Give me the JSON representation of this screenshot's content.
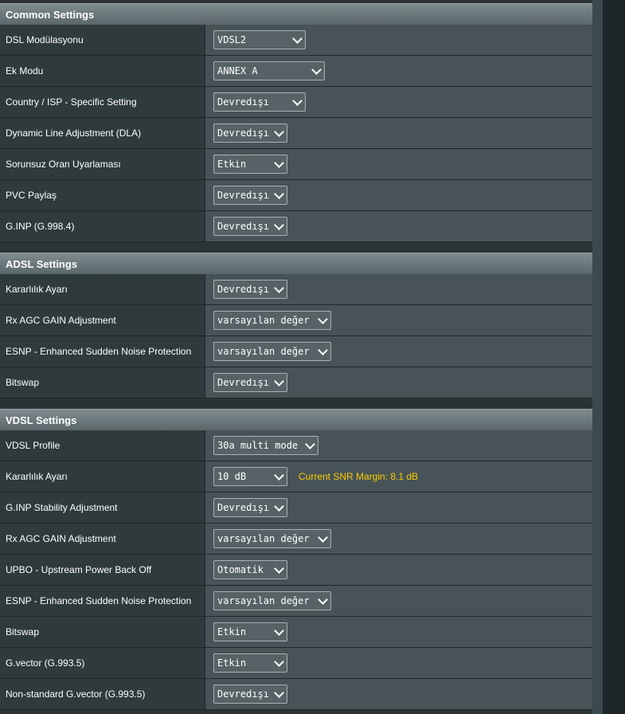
{
  "common": {
    "title": "Common Settings",
    "rows": [
      {
        "label": "DSL Modülasyonu",
        "value": "VDSL2"
      },
      {
        "label": "Ek Modu",
        "value": "ANNEX A"
      },
      {
        "label": "Country / ISP - Specific Setting",
        "value": "Devredışı"
      },
      {
        "label": "Dynamic Line Adjustment (DLA)",
        "value": "Devredışı"
      },
      {
        "label": "Sorunsuz Oran Uyarlaması",
        "value": "Etkin"
      },
      {
        "label": "PVC Paylaş",
        "value": "Devredışı"
      },
      {
        "label": "G.INP (G.998.4)",
        "value": "Devredışı"
      }
    ]
  },
  "adsl": {
    "title": "ADSL Settings",
    "rows": [
      {
        "label": "Kararlılık Ayarı",
        "value": "Devredışı"
      },
      {
        "label": "Rx AGC GAIN Adjustment",
        "value": "varsayılan değer"
      },
      {
        "label": "ESNP - Enhanced Sudden Noise Protection",
        "value": "varsayılan değer"
      },
      {
        "label": "Bitswap",
        "value": "Devredışı"
      }
    ]
  },
  "vdsl": {
    "title": "VDSL Settings",
    "snr_hint": "Current SNR Margin: 8.1 dB",
    "rows": [
      {
        "label": "VDSL Profile",
        "value": "30a multi mode"
      },
      {
        "label": "Kararlılık Ayarı",
        "value": "10 dB"
      },
      {
        "label": "G.INP Stability Adjustment",
        "value": "Devredışı"
      },
      {
        "label": "Rx AGC GAIN Adjustment",
        "value": "varsayılan değer"
      },
      {
        "label": "UPBO - Upstream Power Back Off",
        "value": "Otomatik"
      },
      {
        "label": "ESNP - Enhanced Sudden Noise Protection",
        "value": "varsayılan değer"
      },
      {
        "label": "Bitswap",
        "value": "Etkin"
      },
      {
        "label": "G.vector (G.993.5)",
        "value": "Etkin"
      },
      {
        "label": "Non-standard G.vector (G.993.5)",
        "value": "Devredışı"
      }
    ]
  },
  "icons": {
    "select_arrow": "chevron-down-icon"
  }
}
